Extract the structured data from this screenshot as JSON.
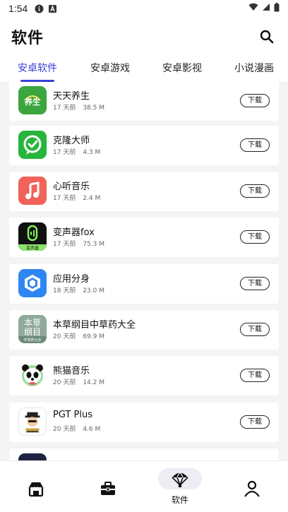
{
  "status_bar": {
    "time": "1:54"
  },
  "header": {
    "title": "软件"
  },
  "tabs": [
    {
      "label": "安卓软件",
      "active": true
    },
    {
      "label": "安卓游戏",
      "active": false
    },
    {
      "label": "安卓影视",
      "active": false
    },
    {
      "label": "小说漫画",
      "active": false
    }
  ],
  "apps": [
    {
      "name": "天天养生",
      "age": "17 天前",
      "size": "38.5 M",
      "button": "下载",
      "icon": "yangsheng-icon",
      "icon_color": "#3aa63d"
    },
    {
      "name": "克隆大师",
      "age": "17 天前",
      "size": "4.3 M",
      "button": "下载",
      "icon": "clone-chat-icon",
      "icon_color": "#27b53c"
    },
    {
      "name": "心听音乐",
      "age": "17 天前",
      "size": "2.4 M",
      "button": "下载",
      "icon": "music-note-icon",
      "icon_color": "#f0625a"
    },
    {
      "name": "变声器fox",
      "age": "17 天前",
      "size": "75.3 M",
      "button": "下载",
      "icon": "microphone-icon",
      "icon_color": "#111111"
    },
    {
      "name": "应用分身",
      "age": "18 天前",
      "size": "23.0 M",
      "button": "下载",
      "icon": "cube-icon",
      "icon_color": "#2f86f2"
    },
    {
      "name": "本草纲目中草药大全",
      "age": "20 天前",
      "size": "69.9 M",
      "button": "下载",
      "icon": "herb-book-icon",
      "icon_color": "#5d7b6a"
    },
    {
      "name": "熊猫音乐",
      "age": "20 天前",
      "size": "14.2 M",
      "button": "下载",
      "icon": "panda-icon",
      "icon_color": "#ffffff"
    },
    {
      "name": "PGT Plus",
      "age": "20 天前",
      "size": "4.6 M",
      "button": "下载",
      "icon": "pgt-icon",
      "icon_color": "#ffffff"
    },
    {
      "name": "",
      "age": "",
      "size": "",
      "button": "",
      "icon": "partial-icon",
      "icon_color": "#1d2340"
    }
  ],
  "bottom_nav": [
    {
      "label": "",
      "icon": "home-stall-icon"
    },
    {
      "label": "",
      "icon": "toolbox-icon"
    },
    {
      "label": "软件",
      "icon": "parachute-icon",
      "active": true
    },
    {
      "label": "",
      "icon": "person-icon"
    }
  ]
}
